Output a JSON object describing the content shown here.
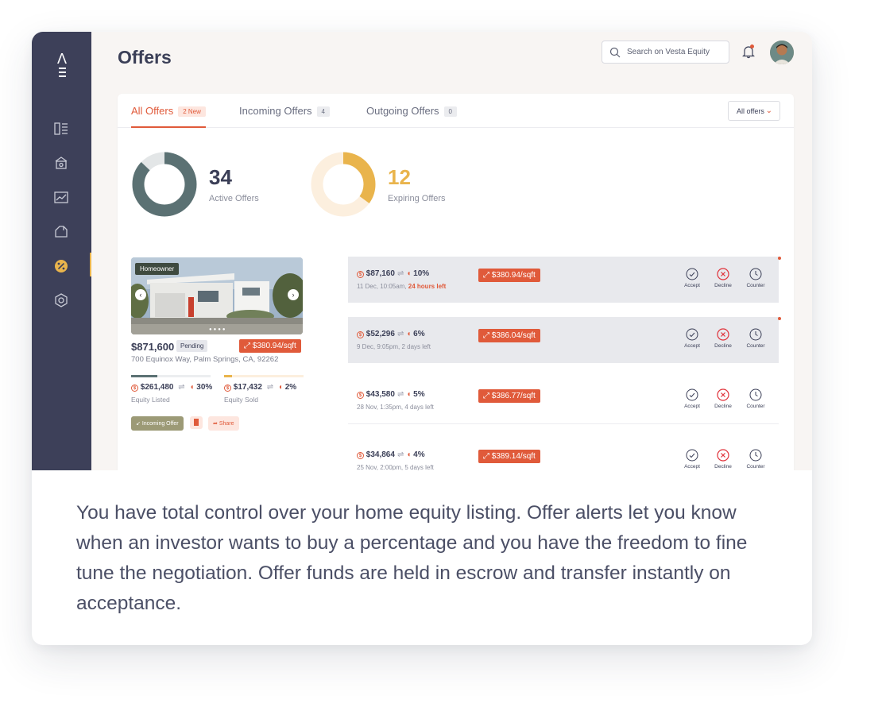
{
  "app": {
    "page_title": "Offers",
    "search_placeholder": "Search on Vesta Equity"
  },
  "sidebar": {
    "items": [
      "dashboard-icon",
      "home-icon",
      "chart-icon",
      "house-icon",
      "percent-icon",
      "settings-icon"
    ],
    "active_item": "percent-icon",
    "accent": "#e9b44c"
  },
  "tabs": [
    {
      "label": "All Offers",
      "badge": "2 New",
      "active": true
    },
    {
      "label": "Incoming Offers",
      "badge": "4",
      "active": false
    },
    {
      "label": "Outgoing Offers",
      "badge": "0",
      "active": false
    }
  ],
  "filter": {
    "label": "All offers"
  },
  "stats": {
    "active": {
      "value": "34",
      "label": "Active Offers",
      "color": "#5b7173"
    },
    "expiring": {
      "value": "12",
      "label": "Expiring Offers",
      "color": "#e9b44c",
      "fraction": 0.35
    }
  },
  "property": {
    "tag": "Homeowner",
    "price": "$871,600",
    "status": "Pending",
    "sqft": "$380.94/sqft",
    "address": "700 Equinox Way, Palm Springs, CA, 92262",
    "equity_listed": {
      "amount": "$261,480",
      "pct": "30%",
      "label": "Equity Listed",
      "fraction": 0.33
    },
    "equity_sold": {
      "amount": "$17,432",
      "pct": "2%",
      "label": "Equity Sold",
      "fraction": 0.1
    },
    "buttons": {
      "incoming": "Incoming Offer",
      "share": "Share"
    }
  },
  "offers": [
    {
      "amount": "$87,160",
      "pct": "10%",
      "date": "11 Dec, 10:05am, ",
      "time_left": "24 hours left",
      "urgent": true,
      "sqft": "$380.94/sqft",
      "highlight": true
    },
    {
      "amount": "$52,296",
      "pct": "6%",
      "date": "9 Dec, 9:05pm, 2 days left",
      "time_left": "",
      "urgent": false,
      "sqft": "$386.04/sqft",
      "highlight": true
    },
    {
      "amount": "$43,580",
      "pct": "5%",
      "date": "28 Nov, 1:35pm, 4 days left",
      "time_left": "",
      "urgent": false,
      "sqft": "$386.77/sqft",
      "highlight": false
    },
    {
      "amount": "$34,864",
      "pct": "4%",
      "date": "25 Nov, 2:00pm, 5 days left",
      "time_left": "",
      "urgent": false,
      "sqft": "$389.14/sqft",
      "highlight": false
    }
  ],
  "actions": {
    "accept": "Accept",
    "decline": "Decline",
    "counter": "Counter"
  },
  "caption": "You have total control over your home equity listing. Offer alerts let you know when an investor wants to buy a percentage and you have the freedom to fine tune the negotiation. Offer funds are held in escrow and transfer instantly on acceptance."
}
